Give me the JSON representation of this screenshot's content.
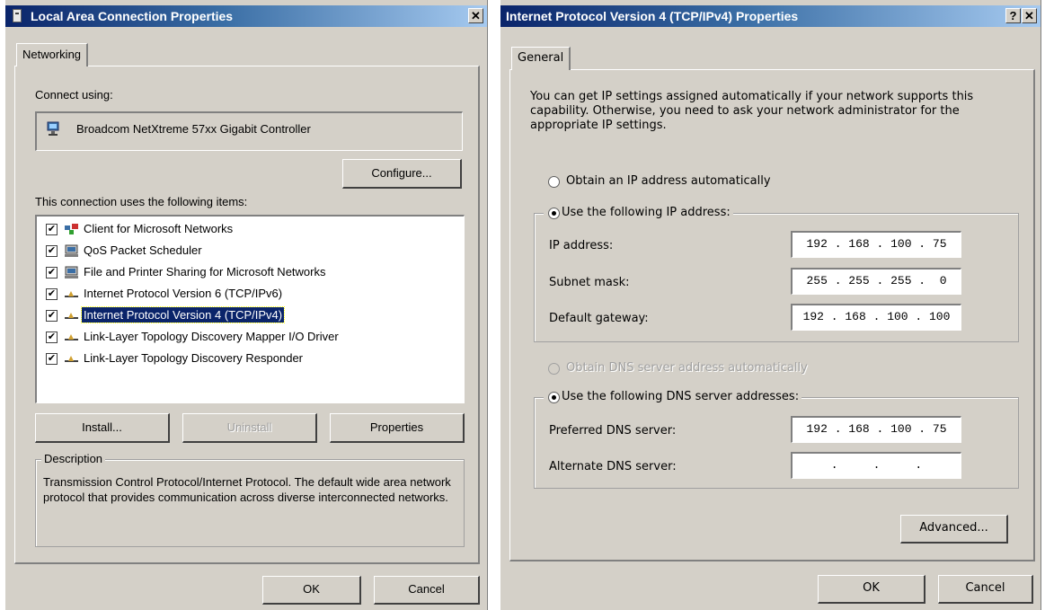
{
  "lan_dialog": {
    "title": "Local Area Connection Properties",
    "close_glyph": "✕",
    "tab": "Networking",
    "connect_using_label": "Connect using:",
    "adapter_name": "Broadcom NetXtreme 57xx Gigabit Controller",
    "configure_button": "Configure...",
    "items_label": "This connection uses the following items:",
    "items": [
      {
        "label": "Client for Microsoft Networks",
        "checked": true,
        "icon": "network-client-icon"
      },
      {
        "label": "QoS Packet Scheduler",
        "checked": true,
        "icon": "service-icon"
      },
      {
        "label": "File and Printer Sharing for Microsoft Networks",
        "checked": true,
        "icon": "service-icon"
      },
      {
        "label": "Internet Protocol Version 6 (TCP/IPv6)",
        "checked": true,
        "icon": "protocol-icon"
      },
      {
        "label": "Internet Protocol Version 4 (TCP/IPv4)",
        "checked": true,
        "icon": "protocol-icon",
        "selected": true
      },
      {
        "label": "Link-Layer Topology Discovery Mapper I/O Driver",
        "checked": true,
        "icon": "protocol-icon"
      },
      {
        "label": "Link-Layer Topology Discovery Responder",
        "checked": true,
        "icon": "protocol-icon"
      }
    ],
    "check_glyph": "✔",
    "install_button": "Install...",
    "uninstall_button": "Uninstall",
    "properties_button": "Properties",
    "description_legend": "Description",
    "description_text": "Transmission Control Protocol/Internet Protocol. The default wide area network protocol that provides communication across diverse interconnected networks.",
    "ok_button": "OK",
    "cancel_button": "Cancel"
  },
  "ipv4_dialog": {
    "title": "Internet Protocol Version 4 (TCP/IPv4) Properties",
    "help_glyph": "?",
    "close_glyph": "✕",
    "tab": "General",
    "intro_text": "You can get IP settings assigned automatically if your network supports this capability. Otherwise, you need to ask your network administrator for the appropriate IP settings.",
    "obtain_ip_auto": "Obtain an IP address automatically",
    "use_following_ip": "Use the following IP address:",
    "ip_address_label": "IP address:",
    "ip_address_value": "192 . 168 . 100 . 75",
    "subnet_mask_label": "Subnet mask:",
    "subnet_mask_value": "255 . 255 . 255 .  0",
    "default_gateway_label": "Default gateway:",
    "default_gateway_value": "192 . 168 . 100 . 100",
    "obtain_dns_auto": "Obtain DNS server address automatically",
    "use_following_dns": "Use the following DNS server addresses:",
    "preferred_dns_label": "Preferred DNS server:",
    "preferred_dns_value": "192 . 168 . 100 . 75",
    "alternate_dns_label": "Alternate DNS server:",
    "alternate_dns_value": "    .     .     .    ",
    "advanced_button": "Advanced...",
    "ok_button": "OK",
    "cancel_button": "Cancel"
  },
  "colors": {
    "dialog_face": "#d4d0c8",
    "title_gradient_start": "#0a246a",
    "title_gradient_end": "#a6caf0",
    "selection": "#0a246a"
  }
}
